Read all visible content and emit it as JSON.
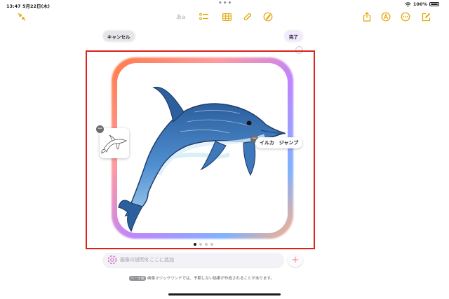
{
  "status_bar": {
    "time": "13:47",
    "date": "5月22日(木)",
    "battery": "100%"
  },
  "toolbar": {
    "format_label": "あa",
    "icons": [
      "collapse-icon",
      "checklist-icon",
      "table-icon",
      "attachment-icon",
      "pencil-tip-icon",
      "share-icon",
      "markup-icon",
      "more-icon",
      "compose-icon"
    ],
    "accent_color": "#e3a300"
  },
  "dialog": {
    "cancel_label": "キャンセル",
    "done_label": "完了"
  },
  "concept": {
    "label": "イルカ　ジャンプ"
  },
  "pager": {
    "count": 4,
    "active_index": 0
  },
  "description": {
    "placeholder": "画像の説明をここに追加"
  },
  "footer": {
    "beta_label": "ベータ版",
    "notice": "画像マジックワンドでは、予期しない結果が作成されることがあります。"
  },
  "colors": {
    "selection": "#e0201b",
    "glow": [
      "#ff7a45",
      "#ff9a9e",
      "#c084fc",
      "#7fb2ff"
    ]
  }
}
